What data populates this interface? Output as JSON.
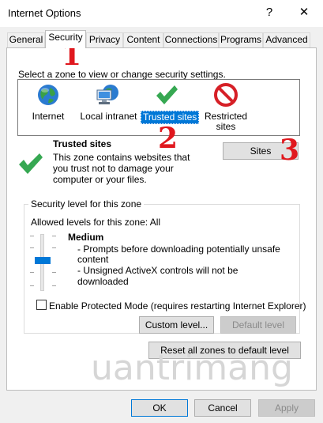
{
  "window": {
    "title": "Internet Options",
    "help_label": "?",
    "close_label": "✕"
  },
  "tabs": [
    {
      "label": "General"
    },
    {
      "label": "Security"
    },
    {
      "label": "Privacy"
    },
    {
      "label": "Content"
    },
    {
      "label": "Connections"
    },
    {
      "label": "Programs"
    },
    {
      "label": "Advanced"
    }
  ],
  "security": {
    "zone_prompt": "Select a zone to view or change security settings.",
    "zones": [
      {
        "label": "Internet",
        "icon": "globe-icon"
      },
      {
        "label": "Local intranet",
        "icon": "network-icon"
      },
      {
        "label": "Trusted sites",
        "icon": "checkmark-icon",
        "selected": true
      },
      {
        "label": "Restricted sites",
        "icon": "prohibited-icon"
      }
    ],
    "selected_zone": {
      "title": "Trusted sites",
      "description": "This zone contains websites that you trust not to damage your computer or your files."
    },
    "sites_button": "Sites",
    "level_group_label": "Security level for this zone",
    "allowed_levels": "Allowed levels for this zone: All",
    "level_name": "Medium",
    "level_points": [
      "- Prompts before downloading potentially unsafe content",
      "- Unsigned ActiveX controls will not be downloaded"
    ],
    "slider_level": 0.6,
    "protected_mode_label": "Enable Protected Mode (requires restarting Internet Explorer)",
    "protected_mode_checked": false,
    "custom_level_button": "Custom level...",
    "default_level_button": "Default level",
    "reset_all_button": "Reset all zones to default level"
  },
  "annotations": [
    "1",
    "2",
    "3"
  ],
  "watermark": "uantrimang",
  "footer": {
    "ok": "OK",
    "cancel": "Cancel",
    "apply": "Apply"
  },
  "colors": {
    "accent": "#0078d7",
    "annotation_red": "#e0181e",
    "check_green": "#2da44e"
  }
}
